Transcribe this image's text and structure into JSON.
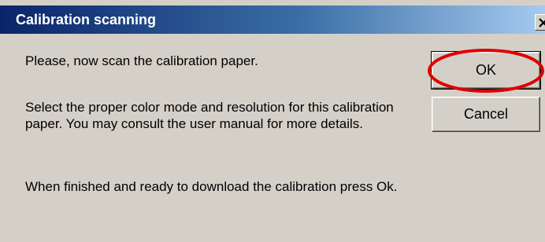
{
  "window": {
    "title": "Calibration scanning"
  },
  "message": {
    "line1": "Please, now scan the calibration paper.",
    "line2": "Select the proper color mode and resolution for this calibration paper. You may consult the user manual for more details.",
    "line3": "When finished and ready to download the calibration press Ok."
  },
  "buttons": {
    "ok_label": "OK",
    "cancel_label": "Cancel"
  },
  "icons": {
    "close": "close-icon"
  },
  "colors": {
    "titlebar_start": "#0a246a",
    "titlebar_end": "#a6caf0",
    "dialog_bg": "#d4d0c8",
    "highlight": "#e00000"
  }
}
